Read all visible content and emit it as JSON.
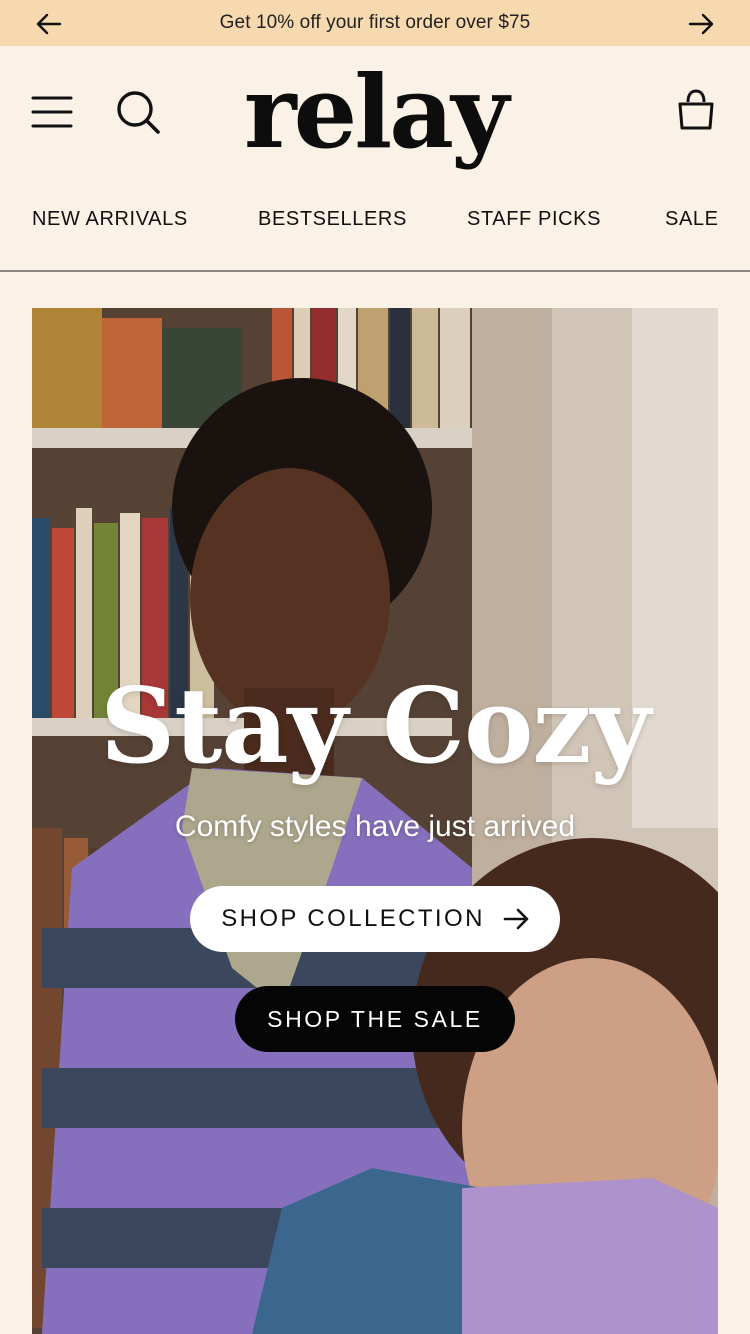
{
  "announcement": {
    "text": "Get 10% off your first order over $75",
    "prev_icon": "arrow-left-icon",
    "next_icon": "arrow-right-icon"
  },
  "header": {
    "logo": "relay",
    "menu_icon": "hamburger-menu-icon",
    "search_icon": "search-icon",
    "cart_icon": "shopping-bag-icon"
  },
  "nav": {
    "items": [
      {
        "label": "NEW ARRIVALS"
      },
      {
        "label": "BESTSELLERS"
      },
      {
        "label": "STAFF PICKS"
      },
      {
        "label": "SALE"
      }
    ]
  },
  "hero": {
    "title": "Stay Cozy",
    "subtitle": "Comfy styles have just arrived",
    "primary_cta": "SHOP COLLECTION",
    "secondary_cta": "SHOP THE SALE",
    "image_alt": "Two children in cozy clothes in front of a bookshelf"
  },
  "colors": {
    "background": "#faf2e6",
    "announcement_bar": "#f7d9b0",
    "text": "#111111",
    "sale_button": "#050505"
  }
}
